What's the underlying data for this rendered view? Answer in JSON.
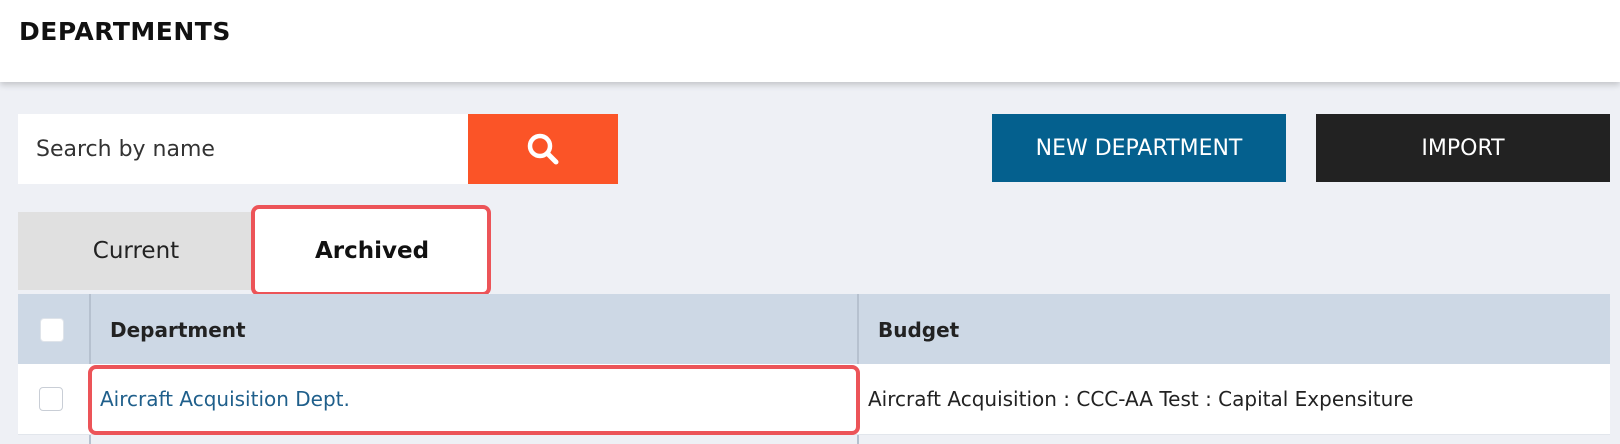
{
  "header": {
    "title": "DEPARTMENTS"
  },
  "search": {
    "placeholder": "Search by name",
    "button_icon": "search-icon",
    "button_color": "#fb5427"
  },
  "actions": {
    "new_department_label": "NEW DEPARTMENT",
    "new_department_color": "#04608e",
    "import_label": "IMPORT",
    "import_color": "#222222"
  },
  "tabs": [
    {
      "label": "Current",
      "selected": false
    },
    {
      "label": "Archived",
      "selected": true
    }
  ],
  "table": {
    "columns": [
      "Department",
      "Budget"
    ],
    "rows": [
      {
        "department": "Aircraft Acquisition Dept.",
        "budget": "Aircraft Acquisition : CCC-AA Test : Capital Expensiture"
      }
    ]
  },
  "highlight_color": "#ec5458"
}
